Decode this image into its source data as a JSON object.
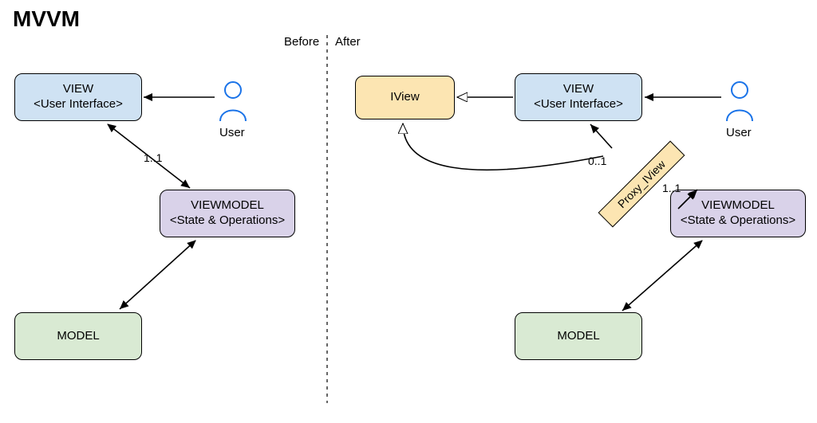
{
  "title": "MVVM",
  "left_label": "Before",
  "right_label": "After",
  "before": {
    "view": {
      "title": "VIEW",
      "subtitle": "<User Interface>"
    },
    "viewmodel": {
      "title": "VIEWMODEL",
      "subtitle": "<State & Operations>"
    },
    "model": {
      "title": "MODEL"
    },
    "user_label": "User",
    "edge_view_vm": "1..1"
  },
  "after": {
    "iview": {
      "title": "IView"
    },
    "view": {
      "title": "VIEW",
      "subtitle": "<User Interface>"
    },
    "proxy": {
      "title": "Proxy_IView"
    },
    "viewmodel": {
      "title": "VIEWMODEL",
      "subtitle": "<State & Operations>"
    },
    "model": {
      "title": "MODEL"
    },
    "user_label": "User",
    "edge_view_proxy": "0..1",
    "edge_proxy_vm": "1..1"
  },
  "colors": {
    "view": "#cfe2f3",
    "viewmodel": "#d9d2e9",
    "model": "#d9ead3",
    "iview_proxy": "#fce5b2",
    "user_stroke": "#1a73e8"
  }
}
